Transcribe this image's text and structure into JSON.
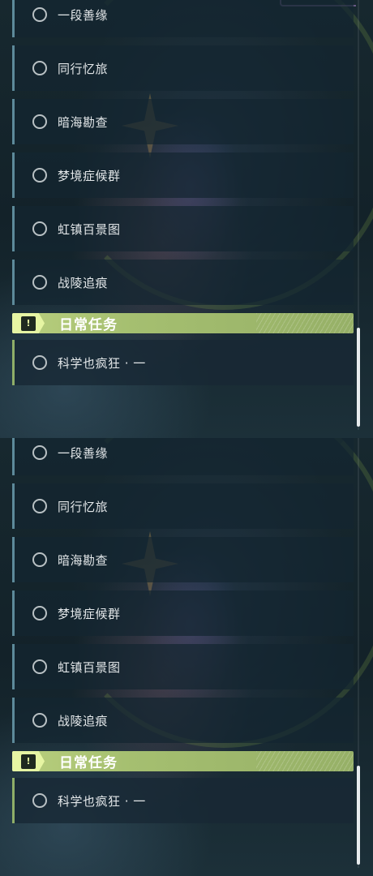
{
  "panels": [
    {
      "quests": [
        {
          "label": "一段善缘"
        },
        {
          "label": "同行忆旅"
        },
        {
          "label": "暗海勘查"
        },
        {
          "label": "梦境症候群"
        },
        {
          "label": "虹镇百景图"
        },
        {
          "label": "战陵追痕"
        }
      ],
      "section": {
        "title": "日常任务",
        "icon": "exclamation-box-icon"
      },
      "daily_quests": [
        {
          "label": "科学也疯狂 · 一"
        }
      ],
      "scroll": {
        "thumb_fraction": 0.23,
        "position": "bottom"
      }
    },
    {
      "quests": [
        {
          "label": "一段善缘"
        },
        {
          "label": "同行忆旅"
        },
        {
          "label": "暗海勘查"
        },
        {
          "label": "梦境症候群"
        },
        {
          "label": "虹镇百景图"
        },
        {
          "label": "战陵追痕"
        }
      ],
      "section": {
        "title": "日常任务",
        "icon": "exclamation-box-icon"
      },
      "daily_quests": [
        {
          "label": "科学也疯狂 · 一"
        }
      ],
      "scroll": {
        "thumb_fraction": 0.23,
        "position": "bottom"
      }
    }
  ],
  "colors": {
    "section_accent": "#b9cf7e",
    "quest_border": "#5d8a9a",
    "daily_border": "#8fae68"
  }
}
